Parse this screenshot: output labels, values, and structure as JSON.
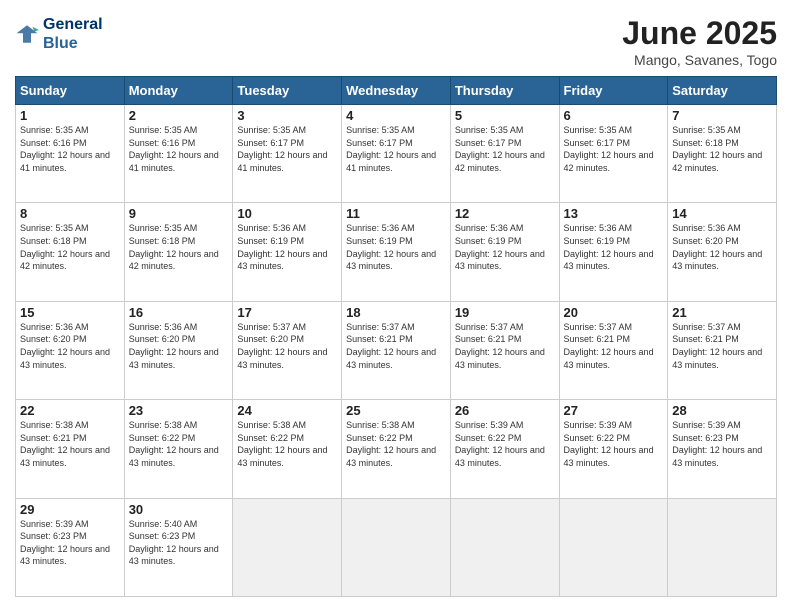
{
  "logo": {
    "line1": "General",
    "line2": "Blue"
  },
  "title": "June 2025",
  "subtitle": "Mango, Savanes, Togo",
  "headers": [
    "Sunday",
    "Monday",
    "Tuesday",
    "Wednesday",
    "Thursday",
    "Friday",
    "Saturday"
  ],
  "weeks": [
    [
      {
        "day": "1",
        "sunrise": "5:35 AM",
        "sunset": "6:16 PM",
        "daylight": "12 hours and 41 minutes."
      },
      {
        "day": "2",
        "sunrise": "5:35 AM",
        "sunset": "6:16 PM",
        "daylight": "12 hours and 41 minutes."
      },
      {
        "day": "3",
        "sunrise": "5:35 AM",
        "sunset": "6:17 PM",
        "daylight": "12 hours and 41 minutes."
      },
      {
        "day": "4",
        "sunrise": "5:35 AM",
        "sunset": "6:17 PM",
        "daylight": "12 hours and 41 minutes."
      },
      {
        "day": "5",
        "sunrise": "5:35 AM",
        "sunset": "6:17 PM",
        "daylight": "12 hours and 42 minutes."
      },
      {
        "day": "6",
        "sunrise": "5:35 AM",
        "sunset": "6:17 PM",
        "daylight": "12 hours and 42 minutes."
      },
      {
        "day": "7",
        "sunrise": "5:35 AM",
        "sunset": "6:18 PM",
        "daylight": "12 hours and 42 minutes."
      }
    ],
    [
      {
        "day": "8",
        "sunrise": "5:35 AM",
        "sunset": "6:18 PM",
        "daylight": "12 hours and 42 minutes."
      },
      {
        "day": "9",
        "sunrise": "5:35 AM",
        "sunset": "6:18 PM",
        "daylight": "12 hours and 42 minutes."
      },
      {
        "day": "10",
        "sunrise": "5:36 AM",
        "sunset": "6:19 PM",
        "daylight": "12 hours and 43 minutes."
      },
      {
        "day": "11",
        "sunrise": "5:36 AM",
        "sunset": "6:19 PM",
        "daylight": "12 hours and 43 minutes."
      },
      {
        "day": "12",
        "sunrise": "5:36 AM",
        "sunset": "6:19 PM",
        "daylight": "12 hours and 43 minutes."
      },
      {
        "day": "13",
        "sunrise": "5:36 AM",
        "sunset": "6:19 PM",
        "daylight": "12 hours and 43 minutes."
      },
      {
        "day": "14",
        "sunrise": "5:36 AM",
        "sunset": "6:20 PM",
        "daylight": "12 hours and 43 minutes."
      }
    ],
    [
      {
        "day": "15",
        "sunrise": "5:36 AM",
        "sunset": "6:20 PM",
        "daylight": "12 hours and 43 minutes."
      },
      {
        "day": "16",
        "sunrise": "5:36 AM",
        "sunset": "6:20 PM",
        "daylight": "12 hours and 43 minutes."
      },
      {
        "day": "17",
        "sunrise": "5:37 AM",
        "sunset": "6:20 PM",
        "daylight": "12 hours and 43 minutes."
      },
      {
        "day": "18",
        "sunrise": "5:37 AM",
        "sunset": "6:21 PM",
        "daylight": "12 hours and 43 minutes."
      },
      {
        "day": "19",
        "sunrise": "5:37 AM",
        "sunset": "6:21 PM",
        "daylight": "12 hours and 43 minutes."
      },
      {
        "day": "20",
        "sunrise": "5:37 AM",
        "sunset": "6:21 PM",
        "daylight": "12 hours and 43 minutes."
      },
      {
        "day": "21",
        "sunrise": "5:37 AM",
        "sunset": "6:21 PM",
        "daylight": "12 hours and 43 minutes."
      }
    ],
    [
      {
        "day": "22",
        "sunrise": "5:38 AM",
        "sunset": "6:21 PM",
        "daylight": "12 hours and 43 minutes."
      },
      {
        "day": "23",
        "sunrise": "5:38 AM",
        "sunset": "6:22 PM",
        "daylight": "12 hours and 43 minutes."
      },
      {
        "day": "24",
        "sunrise": "5:38 AM",
        "sunset": "6:22 PM",
        "daylight": "12 hours and 43 minutes."
      },
      {
        "day": "25",
        "sunrise": "5:38 AM",
        "sunset": "6:22 PM",
        "daylight": "12 hours and 43 minutes."
      },
      {
        "day": "26",
        "sunrise": "5:39 AM",
        "sunset": "6:22 PM",
        "daylight": "12 hours and 43 minutes."
      },
      {
        "day": "27",
        "sunrise": "5:39 AM",
        "sunset": "6:22 PM",
        "daylight": "12 hours and 43 minutes."
      },
      {
        "day": "28",
        "sunrise": "5:39 AM",
        "sunset": "6:23 PM",
        "daylight": "12 hours and 43 minutes."
      }
    ],
    [
      {
        "day": "29",
        "sunrise": "5:39 AM",
        "sunset": "6:23 PM",
        "daylight": "12 hours and 43 minutes."
      },
      {
        "day": "30",
        "sunrise": "5:40 AM",
        "sunset": "6:23 PM",
        "daylight": "12 hours and 43 minutes."
      },
      null,
      null,
      null,
      null,
      null
    ]
  ]
}
